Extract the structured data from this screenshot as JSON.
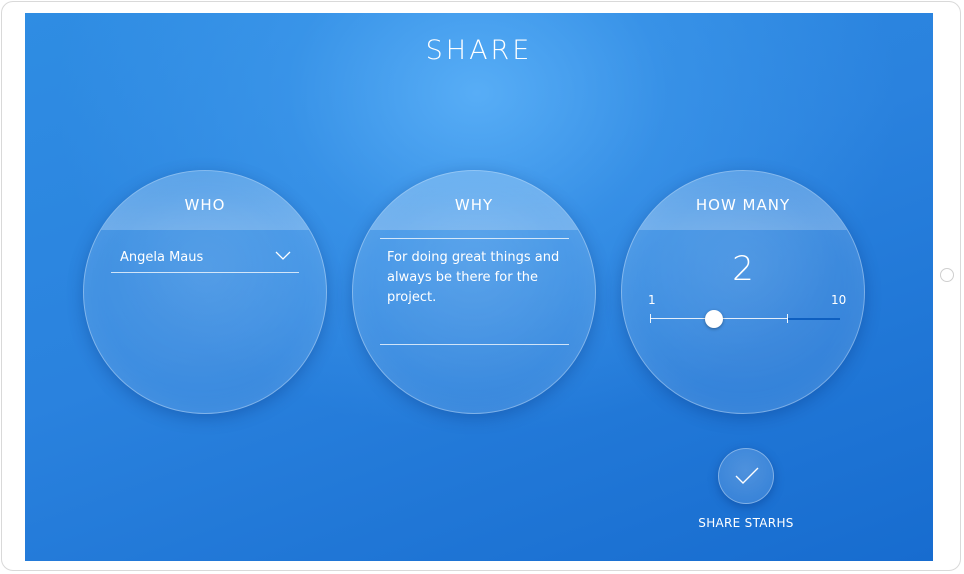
{
  "page": {
    "title": "SHARE"
  },
  "who": {
    "label": "WHO",
    "selected": "Angela Maus",
    "icon": "chevron-down-icon"
  },
  "why": {
    "label": "WHY",
    "text": "For doing great things and\nalways be there for the project."
  },
  "how_many": {
    "label": "HOW MANY",
    "value": "2",
    "min": "1",
    "max": "10",
    "slider_value": 2,
    "slider_min": 1,
    "slider_max": 10
  },
  "share_button": {
    "label": "SHARE STARHS",
    "icon": "check-icon"
  },
  "colors": {
    "background_top": "#2f8de3",
    "background_bottom": "#176ccf",
    "text": "#ffffff",
    "slider_track_rest": "#0e5fc0"
  }
}
